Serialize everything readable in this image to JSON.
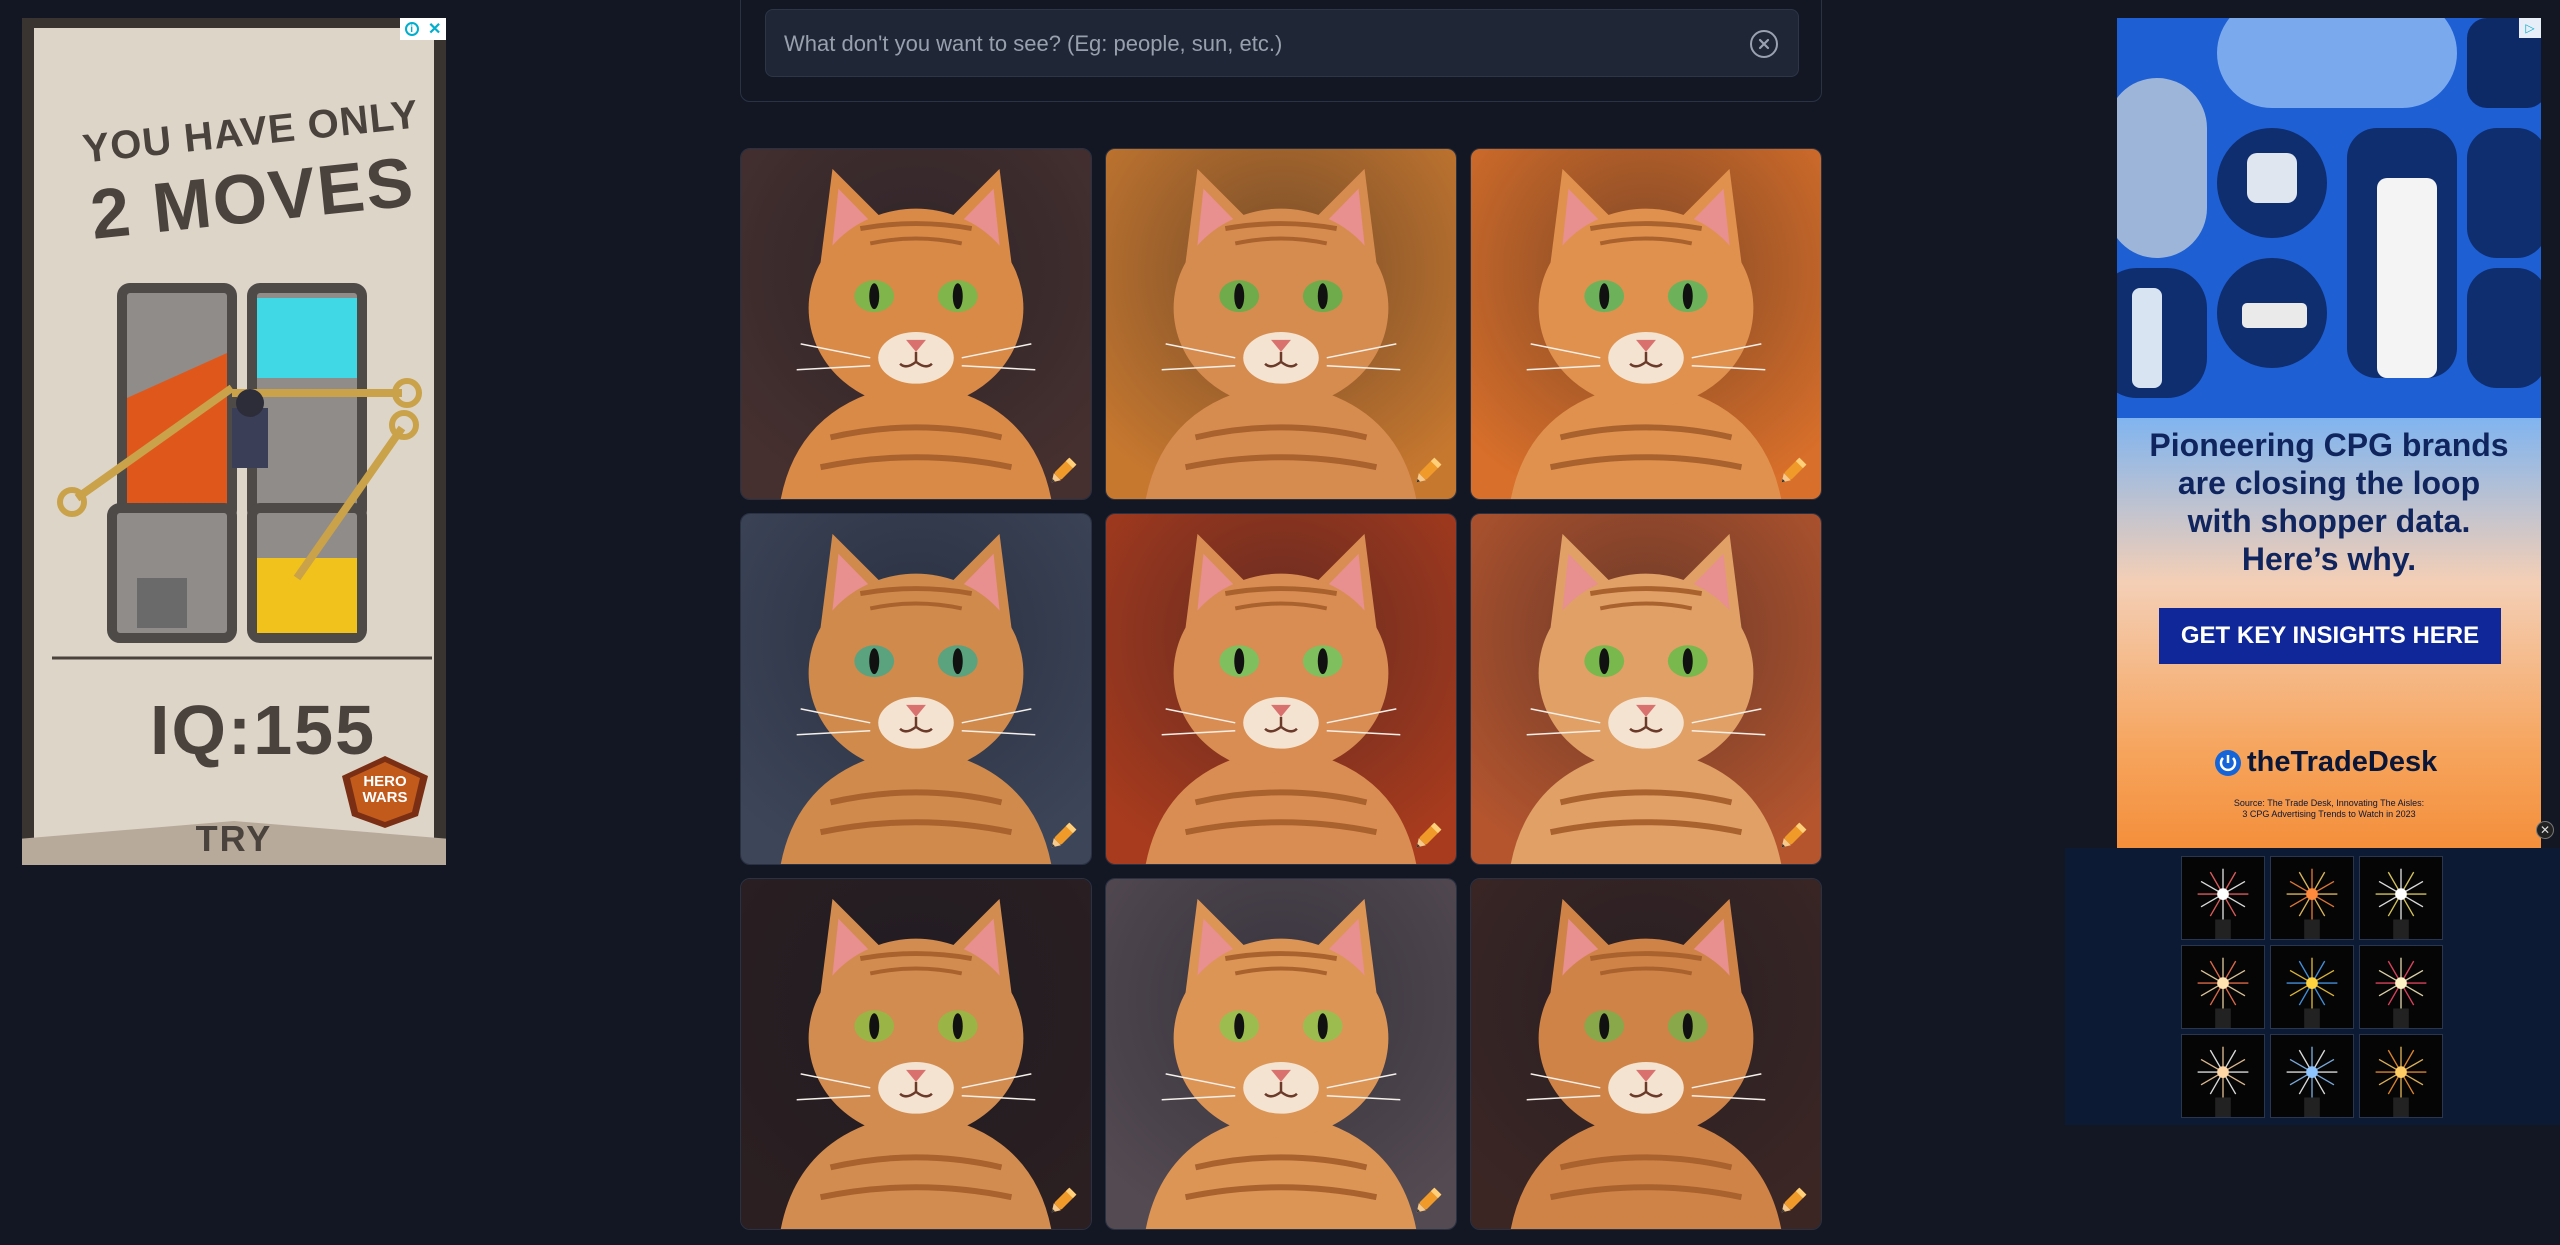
{
  "negative_prompt": {
    "placeholder": "What don't you want to see? (Eg: people, sun, etc.)",
    "value": ""
  },
  "cards": [
    {
      "bg": "#46302f",
      "fur": "#d98a47",
      "eye": "#7fb54a",
      "edit_icon": "pencil-icon"
    },
    {
      "bg": "#c7782f",
      "fur": "#d78c4f",
      "eye": "#6fab4a",
      "edit_icon": "pencil-icon"
    },
    {
      "bg": "#d86f2a",
      "fur": "#e0914d",
      "eye": "#6db25a",
      "edit_icon": "pencil-icon"
    },
    {
      "bg": "#3d4559",
      "fur": "#cf8a4c",
      "eye": "#5aa37e",
      "edit_icon": "pencil-icon"
    },
    {
      "bg": "#a83b1e",
      "fur": "#d98d52",
      "eye": "#7fbf5e",
      "edit_icon": "pencil-icon"
    },
    {
      "bg": "#b4552e",
      "fur": "#e0a066",
      "eye": "#78b84c",
      "edit_icon": "pencil-icon"
    },
    {
      "bg": "#2b1f21",
      "fur": "#d38c50",
      "eye": "#9ab445",
      "edit_icon": "pencil-icon"
    },
    {
      "bg": "#544a52",
      "fur": "#dc9555",
      "eye": "#9dbc4f",
      "edit_icon": "pencil-icon"
    },
    {
      "bg": "#3b2624",
      "fur": "#cf8347",
      "eye": "#88a84a",
      "edit_icon": "pencil-icon"
    }
  ],
  "ad_left": {
    "line1": "YOU HAVE ONLY",
    "line2": "2 MOVES",
    "iq": "IQ:155",
    "brand": "HERO WARS",
    "cta": "TRY"
  },
  "ad_right": {
    "copy_lines": [
      "Pioneering CPG brands",
      "are closing the loop",
      "with shopper data.",
      "Here’s why."
    ],
    "cta": "GET KEY INSIGHTS HERE",
    "logo": "theTradeDesk",
    "source_lines": [
      "Source: The Trade Desk, Innovating The Aisles:",
      "3 CPG Advertising Trends to Watch in 2023"
    ]
  },
  "video_widget": {
    "thumbnails": 9
  },
  "colors": {
    "page_bg": "#121723",
    "panel_border": "#2a3344",
    "field_bg": "#1f2636",
    "pencil": "#f09a2a",
    "cta_blue": "#10279a"
  }
}
